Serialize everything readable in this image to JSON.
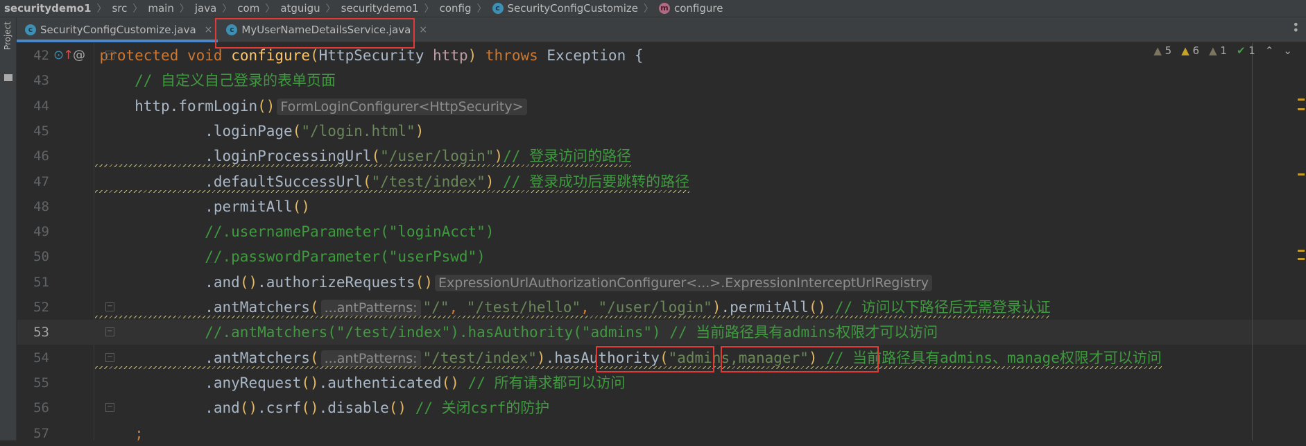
{
  "breadcrumb": [
    {
      "label": "securitydemo1"
    },
    {
      "label": "src"
    },
    {
      "label": "main"
    },
    {
      "label": "java"
    },
    {
      "label": "com"
    },
    {
      "label": "atguigu"
    },
    {
      "label": "securitydemo1"
    },
    {
      "label": "config"
    },
    {
      "label": "SecurityConfigCustomize",
      "icon": "class-icon"
    },
    {
      "label": "configure",
      "icon": "method-icon"
    }
  ],
  "sidebar": {
    "project_label": "Project"
  },
  "tabs": [
    {
      "label": "SecurityConfigCustomize.java",
      "active": true
    },
    {
      "label": "MyUserNameDetailsService.java",
      "active": false
    }
  ],
  "inspections": {
    "weak_warnings": "5",
    "warnings": "6",
    "typos": "1",
    "ok": "1"
  },
  "colors": {
    "accent": "#4a88c7",
    "highlight_box": "#e53935",
    "background": "#2b2b2b"
  },
  "current_line": "53",
  "lines": [
    {
      "n": "42",
      "ind": 4,
      "t": [
        [
          "kw",
          "protected void "
        ],
        [
          "fn",
          "configure"
        ],
        [
          "par",
          "("
        ],
        [
          "",
          "HttpSecurity "
        ],
        [
          "prm",
          "http"
        ],
        [
          "par",
          ")"
        ],
        [
          "kw",
          " throws "
        ],
        [
          "",
          "Exception {"
        ]
      ]
    },
    {
      "n": "43",
      "ind": 8,
      "t": [
        [
          "cm",
          "// 自定义自己登录的表单页面"
        ]
      ]
    },
    {
      "n": "44",
      "ind": 8,
      "t": [
        [
          "",
          "http.formLogin"
        ],
        [
          "par",
          "()"
        ],
        [
          "hint",
          "FormLoginConfigurer<HttpSecurity>"
        ]
      ]
    },
    {
      "n": "45",
      "ind": 16,
      "t": [
        [
          "",
          ".loginPage"
        ],
        [
          "par",
          "("
        ],
        [
          "str",
          "\"/login.html\""
        ],
        [
          "par",
          ")"
        ]
      ]
    },
    {
      "n": "46",
      "ind": 16,
      "sq": true,
      "t": [
        [
          "",
          ".loginProcessingUrl"
        ],
        [
          "par",
          "("
        ],
        [
          "str",
          "\"/user/login\""
        ],
        [
          "par",
          ")"
        ],
        [
          "cm",
          "// 登录访问的路径"
        ]
      ]
    },
    {
      "n": "47",
      "ind": 16,
      "sq": true,
      "t": [
        [
          "",
          ".defaultSuccessUrl"
        ],
        [
          "par",
          "("
        ],
        [
          "str",
          "\"/test/index\""
        ],
        [
          "par",
          ")"
        ],
        [
          "cm",
          " // 登录成功后要跳转的路径"
        ]
      ]
    },
    {
      "n": "48",
      "ind": 16,
      "t": [
        [
          "",
          ".permitAll"
        ],
        [
          "par",
          "()"
        ]
      ]
    },
    {
      "n": "49",
      "ind": 16,
      "t": [
        [
          "cm",
          "//.usernameParameter(\"loginAcct\")"
        ]
      ]
    },
    {
      "n": "50",
      "ind": 16,
      "t": [
        [
          "cm",
          "//.passwordParameter(\"userPswd\")"
        ]
      ]
    },
    {
      "n": "51",
      "ind": 16,
      "t": [
        [
          "",
          ".and"
        ],
        [
          "par",
          "()"
        ],
        [
          "",
          ".authorizeRequests"
        ],
        [
          "par",
          "()"
        ],
        [
          "hint",
          "ExpressionUrlAuthorizationConfigurer<...>.ExpressionInterceptUrlRegistry"
        ]
      ]
    },
    {
      "n": "52",
      "ind": 16,
      "sq": true,
      "t": [
        [
          "",
          ".antMatchers"
        ],
        [
          "par",
          "("
        ],
        [
          "hint",
          "...antPatterns:"
        ],
        [
          "str",
          "\"/\""
        ],
        [
          "kw",
          ", "
        ],
        [
          "str",
          "\"/test/hello\""
        ],
        [
          "kw",
          ", "
        ],
        [
          "str",
          "\"/user/login\""
        ],
        [
          "par",
          ")"
        ],
        [
          "",
          ".permitAll"
        ],
        [
          "par",
          "()"
        ],
        [
          "cm",
          " // 访问以下路径后无需登录认证"
        ]
      ]
    },
    {
      "n": "53",
      "ind": 16,
      "t": [
        [
          "cm",
          "//.antMatchers(\"/test/index\").hasAuthority(\"admins\") // 当前路径具有admins权限才可以访问"
        ]
      ]
    },
    {
      "n": "54",
      "ind": 16,
      "sq": true,
      "t": [
        [
          "",
          ".antMatchers"
        ],
        [
          "par",
          "("
        ],
        [
          "hint",
          "...antPatterns:"
        ],
        [
          "str",
          "\"/test/index\""
        ],
        [
          "par",
          ")"
        ],
        [
          "",
          "."
        ],
        [
          "",
          "hasAuthority"
        ],
        [
          "par",
          "("
        ],
        [
          "str",
          "\"admins,manager\""
        ],
        [
          "par",
          ")"
        ],
        [
          "cm",
          " // 当前路径具有admins、manage权限才可以访问"
        ]
      ]
    },
    {
      "n": "55",
      "ind": 16,
      "t": [
        [
          "",
          ".anyRequest"
        ],
        [
          "par",
          "()"
        ],
        [
          "",
          ".authenticated"
        ],
        [
          "par",
          "()"
        ],
        [
          "cm",
          " // 所有请求都可以访问"
        ]
      ]
    },
    {
      "n": "56",
      "ind": 16,
      "t": [
        [
          "",
          ".and"
        ],
        [
          "par",
          "()"
        ],
        [
          "",
          ".csrf"
        ],
        [
          "par",
          "()"
        ],
        [
          "",
          ".disable"
        ],
        [
          "par",
          "()"
        ],
        [
          "cm",
          " // 关闭csrf的防护"
        ]
      ]
    },
    {
      "n": "57",
      "ind": 8,
      "t": [
        [
          "kw",
          ";"
        ]
      ]
    }
  ]
}
